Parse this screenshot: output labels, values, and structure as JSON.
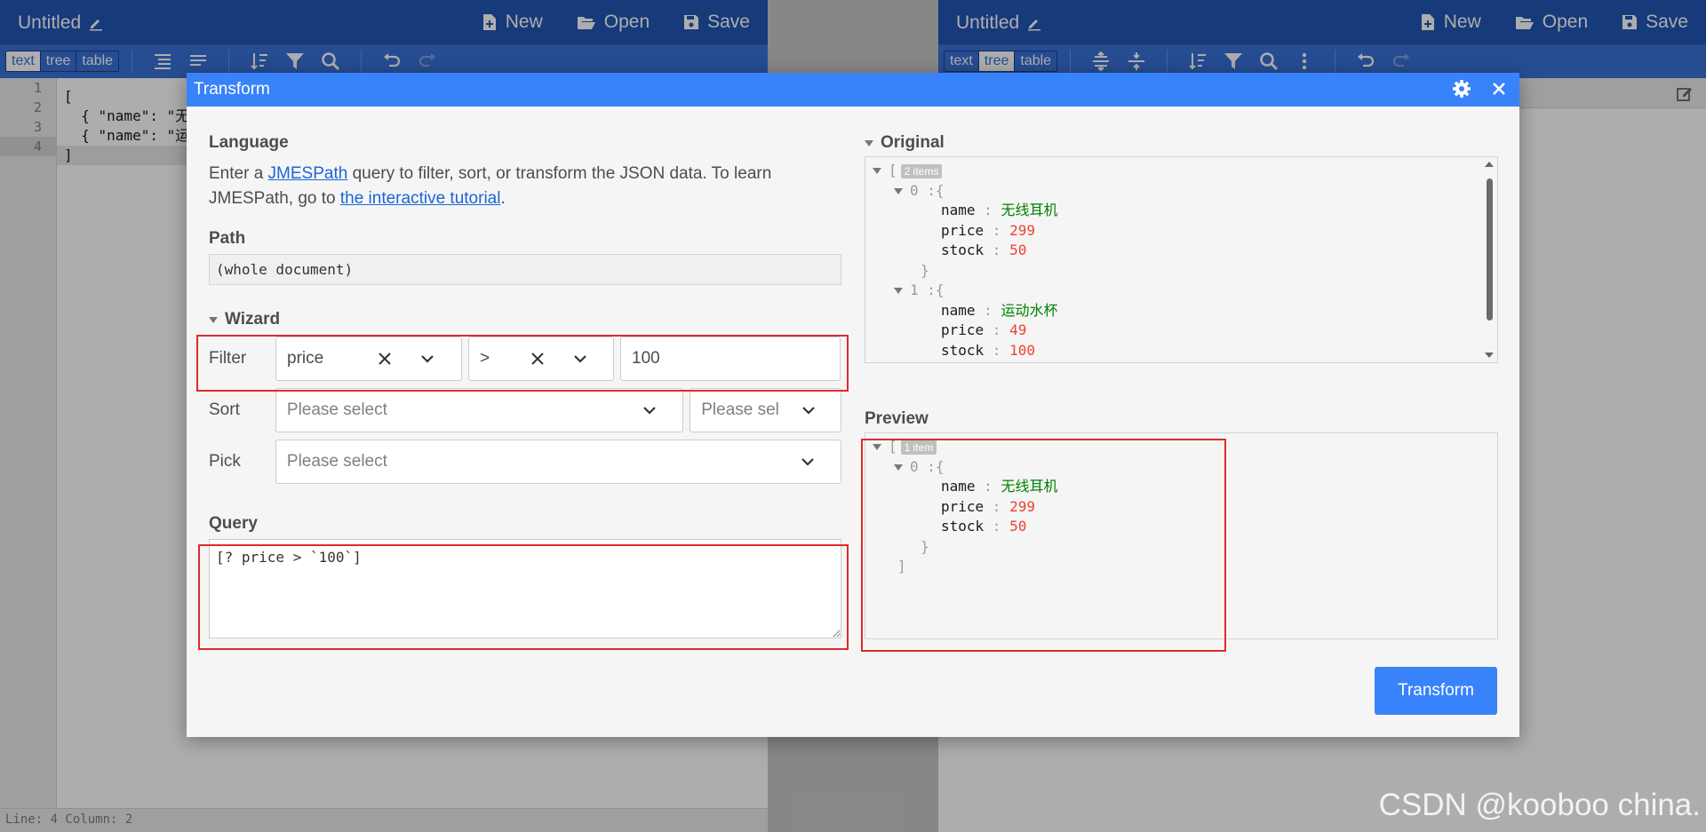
{
  "left_editor": {
    "title": "Untitled",
    "menu": {
      "new": "New",
      "open": "Open",
      "save": "Save"
    },
    "modes": [
      "text",
      "tree",
      "table"
    ],
    "line_numbers": [
      "1",
      "2",
      "3",
      "4"
    ],
    "code_lines": [
      "[",
      "  { \"name\": \"无",
      "  { \"name\": \"运",
      "]"
    ],
    "status": "Line: 4  Column: 2"
  },
  "right_editor": {
    "title": "Untitled",
    "menu": {
      "new": "New",
      "open": "Open",
      "save": "Save"
    },
    "modes": [
      "text",
      "tree",
      "table"
    ]
  },
  "modal": {
    "title": "Transform",
    "language": {
      "heading": "Language",
      "text1": "Enter a ",
      "link1": "JMESPath",
      "text2": " query to filter, sort, or transform the JSON data. To learn JMESPath, go to ",
      "link2": "the interactive tutorial",
      "text3": "."
    },
    "path": {
      "heading": "Path",
      "value": "(whole document)"
    },
    "wizard": {
      "heading": "Wizard",
      "filter": {
        "label": "Filter",
        "field": "price",
        "operator": ">",
        "value": "100"
      },
      "sort": {
        "label": "Sort",
        "field_placeholder": "Please select",
        "direction_placeholder": "Please sel"
      },
      "pick": {
        "label": "Pick",
        "placeholder": "Please select"
      }
    },
    "query": {
      "heading": "Query",
      "value": "[? price > `100`]"
    },
    "original": {
      "heading": "Original",
      "badge": "2 items",
      "items": [
        {
          "index": "0",
          "name": "无线耳机",
          "price": "299",
          "stock": "50"
        },
        {
          "index": "1",
          "name": "运动水杯",
          "price": "49",
          "stock": "100"
        }
      ]
    },
    "preview": {
      "heading": "Preview",
      "badge": "1 item",
      "items": [
        {
          "index": "0",
          "name": "无线耳机",
          "price": "299",
          "stock": "50"
        }
      ]
    },
    "keys": {
      "name": "name",
      "price": "price",
      "stock": "stock"
    },
    "transform_button": "Transform"
  },
  "watermark": "CSDN @kooboo china.",
  "colors": {
    "menubar": "#2156b4",
    "toolbar": "#3871d8",
    "modal_header": "#3883fa",
    "highlight": "#e02a2a"
  }
}
